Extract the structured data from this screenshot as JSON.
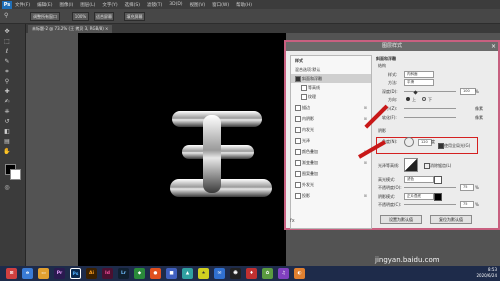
{
  "menubar": {
    "app_icon": "Ps",
    "items": [
      "文件(F)",
      "编辑(E)",
      "图像(I)",
      "图层(L)",
      "文字(Y)",
      "选择(S)",
      "滤镜(T)",
      "3D(D)",
      "视图(V)",
      "窗口(W)",
      "帮助(H)"
    ]
  },
  "options_bar": {
    "buttons": [
      "调整所有窗口",
      "100%",
      "适合屏幕",
      "填充屏幕"
    ]
  },
  "document": {
    "tab_title": "未标题-2 @ 73.2% (王 拷贝 3, RGB/8) ×",
    "status": "73.21%",
    "glyph": "王"
  },
  "dialog": {
    "title": "图层样式",
    "close": "×",
    "style_list_header": "样式",
    "blend_options": "混合选项:默认",
    "styles": [
      {
        "label": "斜面和浮雕",
        "checked": true
      },
      {
        "label": "等高线",
        "checked": false
      },
      {
        "label": "纹理",
        "checked": false
      },
      {
        "label": "描边",
        "checked": false,
        "plus": true
      },
      {
        "label": "内阴影",
        "checked": false,
        "plus": true
      },
      {
        "label": "内发光",
        "checked": false
      },
      {
        "label": "光泽",
        "checked": false
      },
      {
        "label": "颜色叠加",
        "checked": false,
        "plus": true
      },
      {
        "label": "渐变叠加",
        "checked": false,
        "plus": true
      },
      {
        "label": "图案叠加",
        "checked": false
      },
      {
        "label": "外发光",
        "checked": false
      },
      {
        "label": "投影",
        "checked": false,
        "plus": true
      }
    ],
    "fx_label": "fx",
    "section_title": "斜面和浮雕",
    "structure_title": "结构",
    "style_label": "样式:",
    "style_value": "内斜面",
    "method_label": "方法:",
    "method_value": "平滑",
    "depth_label": "深度(D):",
    "depth_value": "100",
    "direction_label": "方向:",
    "direction_up": "上",
    "direction_down": "下",
    "size_label": "大小(Z):",
    "soften_label": "软化(F):",
    "shading_title": "阴影",
    "angle_label": "角度(N):",
    "angle_value": "120",
    "global_light": "使用全局光(G)",
    "gloss_label": "光泽等高线:",
    "antialias": "消除锯齿(L)",
    "highlight_label": "高光模式:",
    "highlight_value": "滤色",
    "opacity1_label": "不透明度(O):",
    "opacity1_value": "75",
    "shadow_label": "阴影模式:",
    "shadow_value": "正片叠底",
    "opacity2_label": "不透明度(C):",
    "opacity2_value": "75",
    "btn_default": "设置为默认值",
    "btn_reset": "复位为默认值",
    "percent": "%",
    "px": "像素",
    "degree": "度"
  },
  "taskbar": {
    "apps": [
      "Pr",
      "Ps",
      "Ai",
      "Id",
      "Lr"
    ],
    "time": "8:53",
    "date": "2020/6/24"
  },
  "watermark": "jingyan.baidu.com",
  "colors": {
    "dialog_border": "#c86080",
    "highlight_box": "#d42020",
    "arrow": "#c81818"
  }
}
